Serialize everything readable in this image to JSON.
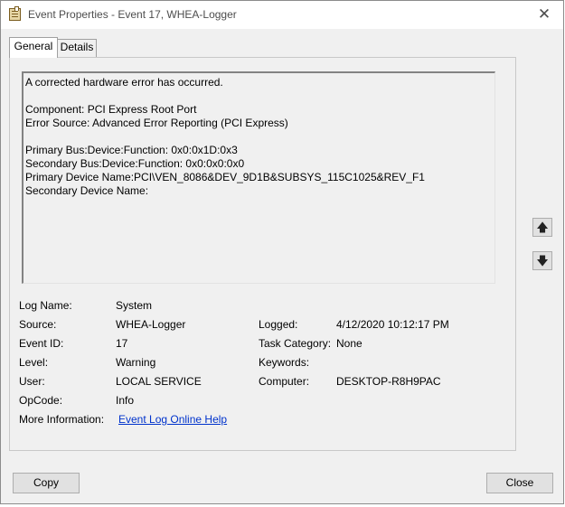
{
  "window": {
    "title": "Event Properties - Event 17, WHEA-Logger",
    "close_glyph": "✕"
  },
  "tabs": [
    {
      "label": "General",
      "selected": true
    },
    {
      "label": "Details",
      "selected": false
    }
  ],
  "description": {
    "line1": "A corrected hardware error has occurred.",
    "line2": "Component: PCI Express Root Port",
    "line3": "Error Source: Advanced Error Reporting (PCI Express)",
    "line4": "Primary Bus:Device:Function: 0x0:0x1D:0x3",
    "line5": "Secondary Bus:Device:Function: 0x0:0x0:0x0",
    "line6": "Primary Device Name:PCI\\VEN_8086&DEV_9D1B&SUBSYS_115C1025&REV_F1",
    "line7": "Secondary Device Name:"
  },
  "scroll_buttons": {
    "up_icon": "arrow-up-icon",
    "down_icon": "arrow-down-icon"
  },
  "fields": {
    "log_name": {
      "label": "Log Name:",
      "value": "System"
    },
    "source": {
      "label": "Source:",
      "value": "WHEA-Logger"
    },
    "logged": {
      "label": "Logged:",
      "value": "4/12/2020 10:12:17 PM"
    },
    "event_id": {
      "label": "Event ID:",
      "value": "17"
    },
    "task_category": {
      "label": "Task Category:",
      "value": "None"
    },
    "level": {
      "label": "Level:",
      "value": "Warning"
    },
    "keywords": {
      "label": "Keywords:",
      "value": ""
    },
    "user": {
      "label": "User:",
      "value": "LOCAL SERVICE"
    },
    "computer": {
      "label": "Computer:",
      "value": "DESKTOP-R8H9PAC"
    },
    "opcode": {
      "label": "OpCode:",
      "value": "Info"
    },
    "more_info": {
      "label": "More Information:",
      "value": "Event Log Online Help"
    }
  },
  "buttons": {
    "copy": "Copy",
    "close": "Close"
  },
  "colors": {
    "link": "#0033cc",
    "background": "#f0f0f0"
  }
}
